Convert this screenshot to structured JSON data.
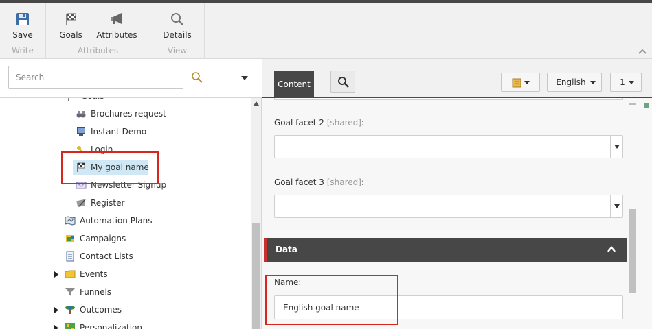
{
  "ribbon": {
    "groups": [
      {
        "label": "Write",
        "buttons": [
          {
            "label": "Save",
            "icon": "save-icon"
          }
        ]
      },
      {
        "label": "Attributes",
        "buttons": [
          {
            "label": "Goals",
            "icon": "goal-flag-icon"
          },
          {
            "label": "Attributes",
            "icon": "megaphone-icon"
          }
        ]
      },
      {
        "label": "View",
        "buttons": [
          {
            "label": "Details",
            "icon": "magnifier-icon"
          }
        ]
      }
    ]
  },
  "search": {
    "placeholder": "Search"
  },
  "tree": {
    "items": [
      {
        "label": "Goals",
        "icon": "goal-flag-icon",
        "level": 1
      },
      {
        "label": "Brochures request",
        "icon": "binoculars-icon",
        "level": 2
      },
      {
        "label": "Instant Demo",
        "icon": "monitor-icon",
        "level": 2
      },
      {
        "label": "Login",
        "icon": "key-icon",
        "level": 2
      },
      {
        "label": "My goal name",
        "icon": "goal-flag-icon",
        "level": 2,
        "selected": true
      },
      {
        "label": "Newsletter Signup",
        "icon": "envelope-icon",
        "level": 2
      },
      {
        "label": "Register",
        "icon": "register-pen-icon",
        "level": 2
      },
      {
        "label": "Automation Plans",
        "icon": "map-icon",
        "level": 1
      },
      {
        "label": "Campaigns",
        "icon": "campaigns-icon",
        "level": 1
      },
      {
        "label": "Contact Lists",
        "icon": "contact-list-icon",
        "level": 1
      },
      {
        "label": "Events",
        "icon": "folder-icon",
        "level": 1,
        "expandable": true
      },
      {
        "label": "Funnels",
        "icon": "funnel-icon",
        "level": 1
      },
      {
        "label": "Outcomes",
        "icon": "outcomes-icon",
        "level": 1,
        "expandable": true
      },
      {
        "label": "Personalization",
        "icon": "personalization-icon",
        "level": 1,
        "expandable": true
      }
    ]
  },
  "editor_header": {
    "tab_content": "Content",
    "search_icon": "search-icon",
    "version_icon": "book-icon",
    "language": "English",
    "version_number": "1"
  },
  "editor": {
    "goal_facet_2_label": "Goal facet 2",
    "goal_facet_3_label": "Goal facet 3",
    "shared_tag": "[shared]",
    "colon": ":",
    "section_title": "Data",
    "name_label": "Name:",
    "name_value": "English goal name"
  },
  "colors": {
    "dark_header": "#474747",
    "highlight_box": "#d9261c",
    "selected_row": "#d0e8f5",
    "section_accent": "#c9302c"
  }
}
